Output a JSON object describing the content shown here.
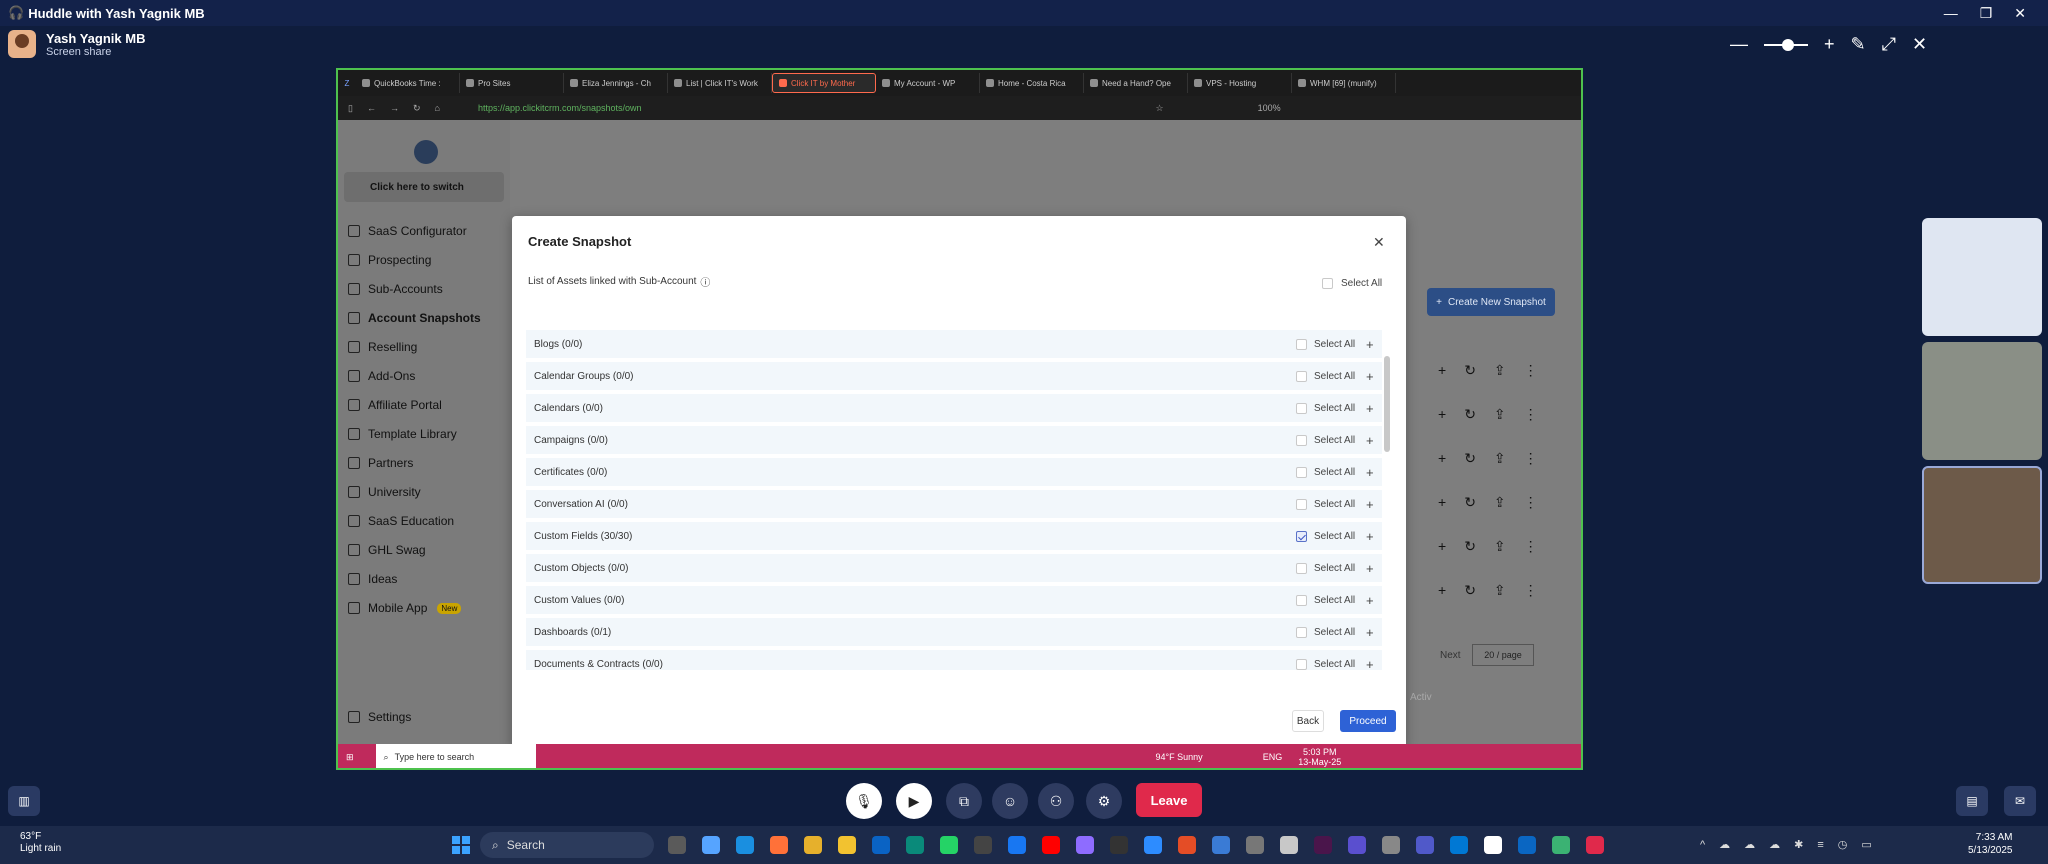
{
  "huddle": {
    "title": "Huddle with Yash Yagnik MB",
    "presenter_name": "Yash Yagnik MB",
    "presenter_status": "Screen share"
  },
  "browser": {
    "tabs": [
      {
        "label": "QuickBooks Time :"
      },
      {
        "label": "Pro Sites"
      },
      {
        "label": "Eliza Jennings - Ch"
      },
      {
        "label": "List | Click IT's Work"
      },
      {
        "label": "Click IT by Mother",
        "active": true
      },
      {
        "label": "My Account - WP"
      },
      {
        "label": "Home - Costa Rica"
      },
      {
        "label": "Need a Hand? Ope"
      },
      {
        "label": "VPS - Hosting"
      },
      {
        "label": "WHM [69] (munify)"
      }
    ],
    "url": "https://app.clickitcrm.com/snapshots/own",
    "zoom": "100%"
  },
  "sidebar": {
    "switcher_label": "Click here to switch",
    "items": [
      {
        "label": "SaaS Configurator"
      },
      {
        "label": "Prospecting"
      },
      {
        "label": "Sub-Accounts"
      },
      {
        "label": "Account Snapshots",
        "selected": true
      },
      {
        "label": "Reselling"
      },
      {
        "label": "Add-Ons"
      },
      {
        "label": "Affiliate Portal"
      },
      {
        "label": "Template Library"
      },
      {
        "label": "Partners"
      },
      {
        "label": "University"
      },
      {
        "label": "SaaS Education"
      },
      {
        "label": "GHL Swag"
      },
      {
        "label": "Ideas"
      },
      {
        "label": "Mobile App",
        "badge": "New"
      }
    ],
    "settings_label": "Settings"
  },
  "main": {
    "create_button": "Create New Snapshot",
    "pagination_next": "Next",
    "page_size": "20 / page",
    "watermark": "Activ"
  },
  "modal": {
    "title": "Create Snapshot",
    "assets_label": "List of Assets linked with Sub-Account",
    "select_all_label": "Select All",
    "rows": [
      {
        "label": "Blogs (0/0)",
        "checked": false
      },
      {
        "label": "Calendar Groups (0/0)",
        "checked": false
      },
      {
        "label": "Calendars (0/0)",
        "checked": false
      },
      {
        "label": "Campaigns (0/0)",
        "checked": false
      },
      {
        "label": "Certificates (0/0)",
        "checked": false
      },
      {
        "label": "Conversation AI (0/0)",
        "checked": false
      },
      {
        "label": "Custom Fields (30/30)",
        "checked": true
      },
      {
        "label": "Custom Objects (0/0)",
        "checked": false
      },
      {
        "label": "Custom Values (0/0)",
        "checked": false
      },
      {
        "label": "Dashboards (0/1)",
        "checked": false
      },
      {
        "label": "Documents & Contracts (0/0)",
        "checked": false
      }
    ],
    "back_label": "Back",
    "proceed_label": "Proceed"
  },
  "inner_taskbar": {
    "search_placeholder": "Type here to search",
    "weather": "94°F  Sunny",
    "lang": "ENG",
    "time": "5:03 PM",
    "date": "13-May-25"
  },
  "call": {
    "leave_label": "Leave"
  },
  "taskbar": {
    "temp": "63°F",
    "weather": "Light rain",
    "search_label": "Search",
    "time": "7:33 AM",
    "date": "5/13/2025"
  },
  "colors": {
    "leave": "#e0294b",
    "proceed": "#2e62d6",
    "share_border": "#4ec24e",
    "inner_taskbar": "#bf2a5c"
  }
}
